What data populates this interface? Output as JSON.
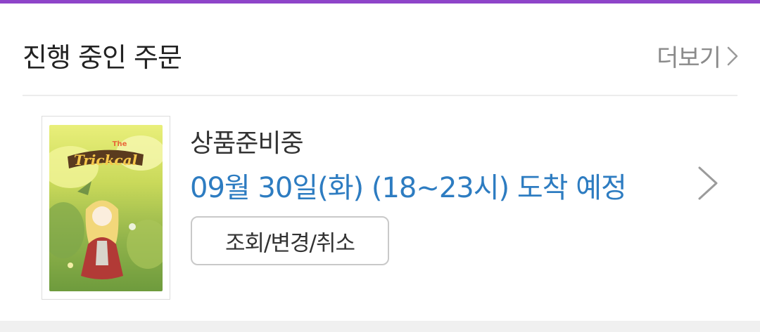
{
  "colors": {
    "accent_bar": "#8e44c9",
    "delivery_text": "#2d7cc1",
    "muted_text": "#8a8a8a"
  },
  "header": {
    "title": "진행 중인 주문",
    "more_label": "더보기",
    "more_icon": "chevron-right-icon"
  },
  "order": {
    "thumbnail_alt": "Trickcal",
    "status": "상품준비중",
    "delivery": "09월 30일(화) (18~23시) 도착 예정",
    "action_label": "조회/변경/취소",
    "row_icon": "chevron-right-icon"
  }
}
